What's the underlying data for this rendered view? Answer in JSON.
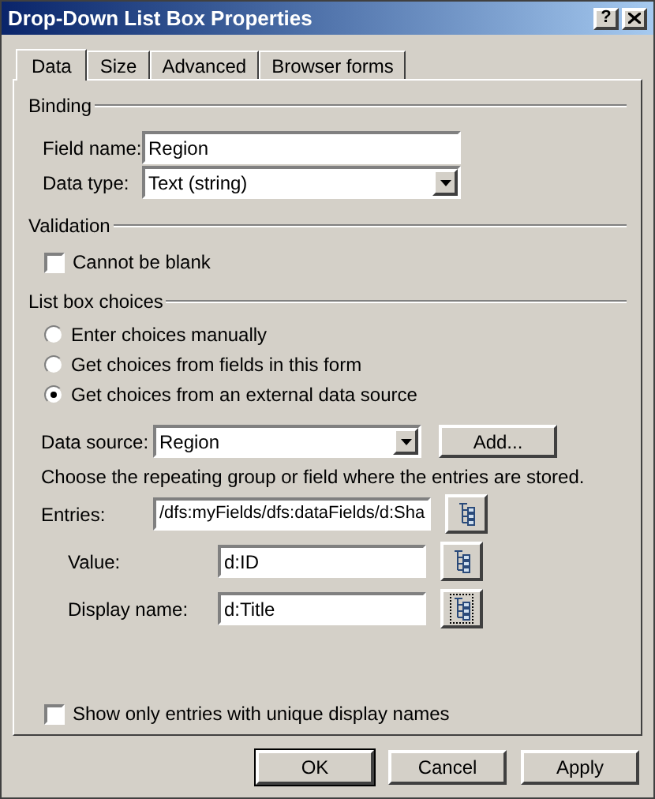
{
  "window": {
    "title": "Drop-Down List Box Properties",
    "help": "?"
  },
  "tabs": [
    {
      "label": "Data",
      "selected": true
    },
    {
      "label": "Size",
      "selected": false
    },
    {
      "label": "Advanced",
      "selected": false
    },
    {
      "label": "Browser forms",
      "selected": false
    }
  ],
  "binding": {
    "heading": "Binding",
    "field_name": {
      "label": "Field name:",
      "value": "Region"
    },
    "data_type": {
      "label": "Data type:",
      "value": "Text (string)"
    }
  },
  "validation": {
    "heading": "Validation",
    "cannot_be_blank": {
      "label": "Cannot be blank",
      "checked": false
    }
  },
  "list_box_choices": {
    "heading": "List box choices",
    "options": [
      {
        "label": "Enter choices manually",
        "selected": false
      },
      {
        "label": "Get choices from fields in this form",
        "selected": false
      },
      {
        "label": "Get choices from an external data source",
        "selected": true
      }
    ],
    "data_source": {
      "label": "Data source:",
      "value": "Region"
    },
    "add_button": "Add...",
    "instruction": "Choose the repeating group or field where the entries are stored.",
    "entries": {
      "label": "Entries:",
      "value": "/dfs:myFields/dfs:dataFields/d:Sha",
      "focused": false
    },
    "value": {
      "label": "Value:",
      "value": "d:ID",
      "focused": false
    },
    "display_name": {
      "label": "Display name:",
      "value": "d:Title",
      "focused": true
    }
  },
  "unique_names": {
    "label": "Show only entries with unique display names",
    "checked": false
  },
  "buttons": [
    {
      "label": "OK",
      "default": true
    },
    {
      "label": "Cancel",
      "default": false
    },
    {
      "label": "Apply",
      "default": false
    }
  ]
}
